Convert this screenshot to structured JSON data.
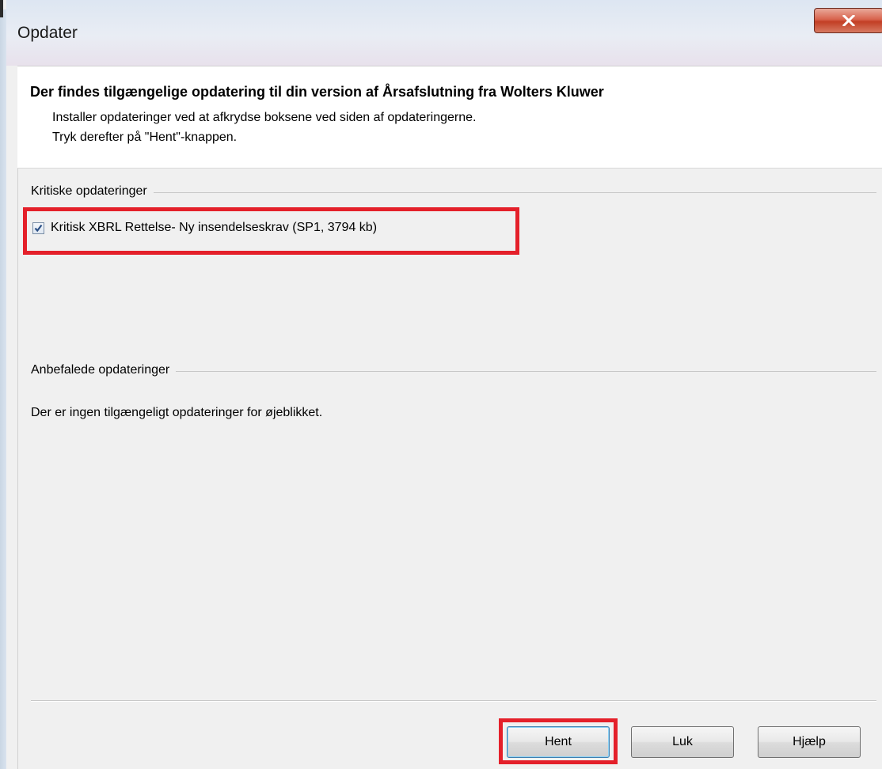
{
  "window": {
    "title": "Opdater",
    "close_icon": "close-x-icon"
  },
  "header": {
    "title": "Der findes tilgængelige opdatering til din version af Årsafslutning fra Wolters Kluwer",
    "line1": "Installer opdateringer ved at afkrydse boksene ved siden af opdateringerne.",
    "line2": "Tryk derefter på \"Hent\"-knappen."
  },
  "critical": {
    "group_label": "Kritiske opdateringer",
    "items": [
      {
        "label": "Kritisk XBRL Rettelse- Ny insendelseskrav (SP1, 3794 kb)",
        "checked": true
      }
    ]
  },
  "recommended": {
    "group_label": "Anbefalede opdateringer",
    "empty_text": "Der er ingen tilgængeligt opdateringer for øjeblikket."
  },
  "buttons": {
    "download": "Hent",
    "close": "Luk",
    "help": "Hjælp"
  },
  "colors": {
    "highlight": "#e4202a",
    "close_button": "#c23e24"
  }
}
